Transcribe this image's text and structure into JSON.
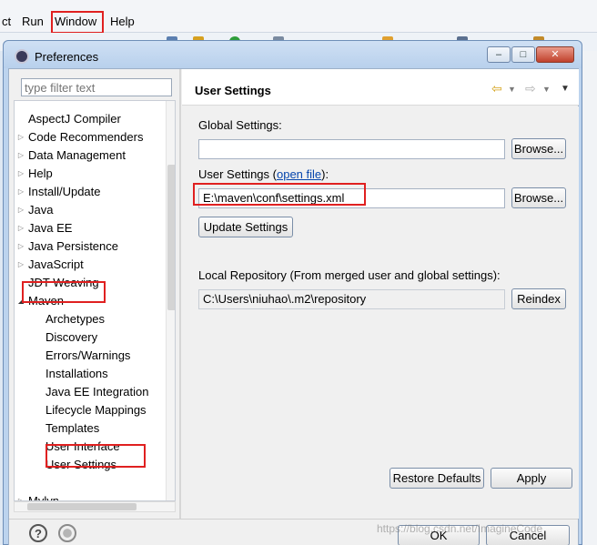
{
  "menubar": {
    "items": [
      {
        "label": "ct"
      },
      {
        "label": "Run"
      },
      {
        "label": "Window"
      },
      {
        "label": "Help"
      }
    ]
  },
  "dialog": {
    "title": "Preferences",
    "window_controls": {
      "minimize": "–",
      "maximize": "□",
      "close": "✕"
    }
  },
  "left_pane": {
    "filter_placeholder": "type filter text",
    "tree": [
      {
        "label": "AspectJ Compiler",
        "level": 0,
        "arrow": "none"
      },
      {
        "label": "Code Recommenders",
        "level": 0,
        "arrow": "collapsed"
      },
      {
        "label": "Data Management",
        "level": 0,
        "arrow": "collapsed"
      },
      {
        "label": "Help",
        "level": 0,
        "arrow": "collapsed"
      },
      {
        "label": "Install/Update",
        "level": 0,
        "arrow": "collapsed"
      },
      {
        "label": "Java",
        "level": 0,
        "arrow": "collapsed"
      },
      {
        "label": "Java EE",
        "level": 0,
        "arrow": "collapsed"
      },
      {
        "label": "Java Persistence",
        "level": 0,
        "arrow": "collapsed"
      },
      {
        "label": "JavaScript",
        "level": 0,
        "arrow": "collapsed"
      },
      {
        "label": "JDT Weaving",
        "level": 0,
        "arrow": "none"
      },
      {
        "label": "Maven",
        "level": 0,
        "arrow": "expanded"
      },
      {
        "label": "Archetypes",
        "level": 1,
        "arrow": "none"
      },
      {
        "label": "Discovery",
        "level": 1,
        "arrow": "none"
      },
      {
        "label": "Errors/Warnings",
        "level": 1,
        "arrow": "none"
      },
      {
        "label": "Installations",
        "level": 1,
        "arrow": "none"
      },
      {
        "label": "Java EE Integration",
        "level": 1,
        "arrow": "none"
      },
      {
        "label": "Lifecycle Mappings",
        "level": 1,
        "arrow": "none"
      },
      {
        "label": "Templates",
        "level": 1,
        "arrow": "none"
      },
      {
        "label": "User Interface",
        "level": 1,
        "arrow": "none"
      },
      {
        "label": "User Settings",
        "level": 1,
        "arrow": "none",
        "selected": true
      },
      {
        "label": "Mylyn",
        "level": 0,
        "arrow": "collapsed"
      }
    ]
  },
  "right_pane": {
    "title": "User Settings",
    "global_settings_label": "Global Settings:",
    "global_settings_value": "",
    "user_settings_label_prefix": "User Settings (",
    "user_settings_link": "open file",
    "user_settings_label_suffix": "):",
    "user_settings_value": "E:\\maven\\conf\\settings.xml",
    "browse_label": "Browse...",
    "update_settings_label": "Update Settings",
    "local_repo_label": "Local Repository (From merged user and global settings):",
    "local_repo_value": "C:\\Users\\niuhao\\.m2\\repository",
    "reindex_label": "Reindex",
    "restore_defaults_label": "Restore Defaults",
    "apply_label": "Apply"
  },
  "footer": {
    "help_icon": "?",
    "ok_label": "OK",
    "cancel_label": "Cancel"
  },
  "watermark": "https://blog.csdn.net/ImagineCode",
  "colors": {
    "highlight": "#e02020",
    "selection": "#cfe3f9",
    "link": "#0645ad"
  }
}
